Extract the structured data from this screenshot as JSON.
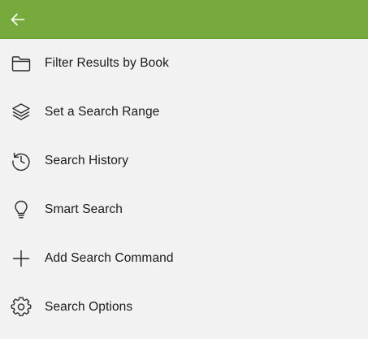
{
  "colors": {
    "header_bg": "#77aa3c",
    "panel_bg": "#f2f2f2",
    "text": "#1a1a1a",
    "icon_stroke": "#2b2b2b"
  },
  "header": {
    "back_icon": "arrow-left-icon"
  },
  "menu": {
    "items": [
      {
        "label": "Filter Results by Book",
        "icon": "folder-icon"
      },
      {
        "label": "Set a Search Range",
        "icon": "layers-icon"
      },
      {
        "label": "Search History",
        "icon": "history-icon"
      },
      {
        "label": "Smart Search",
        "icon": "lightbulb-icon"
      },
      {
        "label": "Add Search Command",
        "icon": "plus-icon"
      },
      {
        "label": "Search Options",
        "icon": "gear-icon"
      }
    ]
  }
}
